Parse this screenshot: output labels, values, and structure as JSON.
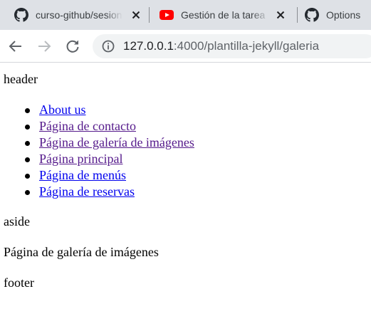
{
  "tabs": [
    {
      "title": "curso-github/sesion",
      "favicon": "github-icon"
    },
    {
      "title": "Gestión de la tarea",
      "favicon": "youtube-icon"
    },
    {
      "title": "Options",
      "favicon": "github-icon"
    }
  ],
  "address_bar": {
    "host": "127.0.0.1",
    "rest": ":4000/plantilla-jekyll/galeria"
  },
  "page": {
    "header": "header",
    "nav": [
      {
        "label": "About us",
        "visited": false
      },
      {
        "label": "Página de contacto",
        "visited": true
      },
      {
        "label": "Página de galería de imágenes",
        "visited": true
      },
      {
        "label": "Página principal",
        "visited": true
      },
      {
        "label": "Página de menús",
        "visited": false
      },
      {
        "label": "Página de reservas",
        "visited": false
      }
    ],
    "aside": "aside",
    "main": "Página de galería de imágenes",
    "footer": "footer"
  },
  "colors": {
    "link": "#0000ee",
    "visited_link": "#551a8b",
    "tabstrip_bg": "#dee1e6",
    "youtube_red": "#ff0000"
  }
}
